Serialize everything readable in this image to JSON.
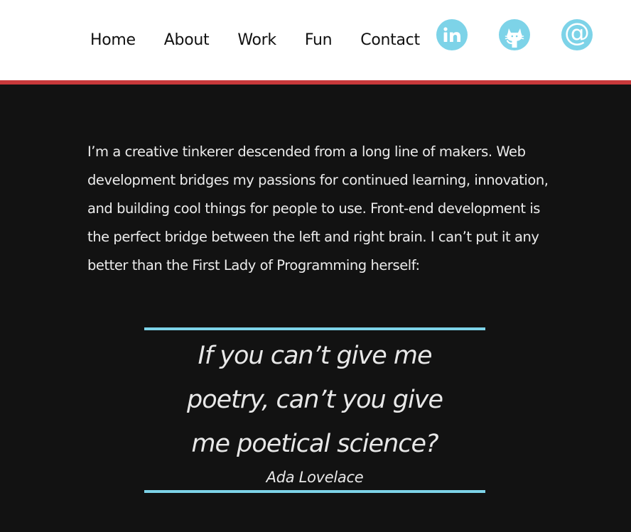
{
  "nav": {
    "items": [
      {
        "label": "Home"
      },
      {
        "label": "About"
      },
      {
        "label": "Work"
      },
      {
        "label": "Fun"
      },
      {
        "label": "Contact"
      }
    ]
  },
  "social": {
    "items": [
      {
        "icon": "linkedin-icon",
        "glyph": "in"
      },
      {
        "icon": "github-icon"
      },
      {
        "icon": "email-icon",
        "glyph": "@"
      }
    ]
  },
  "colors": {
    "accent": "#7dd3e8",
    "header_rule": "#c8393b",
    "background": "#121212",
    "header_bg": "#ffffff"
  },
  "about": {
    "intro": "I’m a creative tinkerer descended from a long line of makers. Web development bridges my passions for continued learning, innovation, and building cool things for people to use.  Front-end development is the perfect bridge between the left and right brain.  I can’t put it any better than the  First  Lady of  Programming herself:"
  },
  "quote": {
    "text": "If you can’t give me poetry, can’t you give me poetical science?",
    "author": "Ada  Lovelace"
  }
}
